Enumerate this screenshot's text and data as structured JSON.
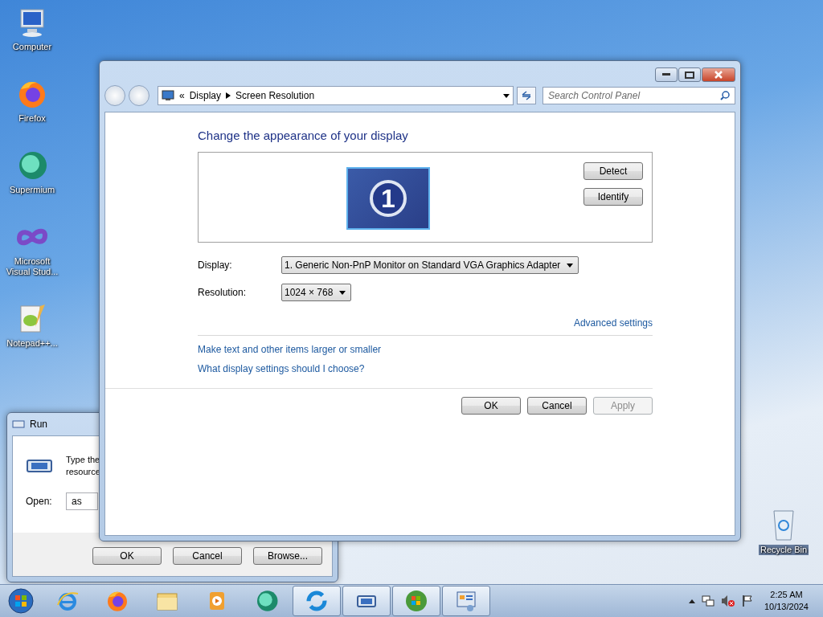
{
  "desktop_icons": [
    {
      "label": "Computer",
      "kind": "computer"
    },
    {
      "label": "Firefox",
      "kind": "firefox"
    },
    {
      "label": "Supermium",
      "kind": "supermium"
    },
    {
      "label": "Microsoft Visual Stud...",
      "kind": "vs"
    },
    {
      "label": "Notepad++...",
      "kind": "notepad"
    }
  ],
  "recycle_bin": {
    "label": "Recycle Bin"
  },
  "run_dialog": {
    "title": "Run",
    "prompt_lines": [
      "Type the",
      "resource"
    ],
    "open_label": "Open:",
    "open_value": "as",
    "buttons": [
      "OK",
      "Cancel",
      "Browse..."
    ]
  },
  "window": {
    "address": {
      "chevron": "«",
      "items": [
        "Display",
        "Screen Resolution"
      ]
    },
    "search": {
      "placeholder": "Search Control Panel"
    },
    "heading": "Change the appearance of your display",
    "monitor_number": "1",
    "preview_buttons": [
      "Detect",
      "Identify"
    ],
    "fields": [
      {
        "label": "Display:",
        "value": "1. Generic Non-PnP Monitor on Standard VGA Graphics Adapter"
      },
      {
        "label": "Resolution:",
        "value": "1024 × 768"
      }
    ],
    "advanced_link": "Advanced settings",
    "links": [
      "Make text and other items larger or smaller",
      "What display settings should I choose?"
    ],
    "buttons": [
      {
        "label": "OK",
        "disabled": false
      },
      {
        "label": "Cancel",
        "disabled": false
      },
      {
        "label": "Apply",
        "disabled": true
      }
    ]
  },
  "taskbar": {
    "pinned": [
      {
        "kind": "ie",
        "running": false
      },
      {
        "kind": "firefox",
        "running": false
      },
      {
        "kind": "folder",
        "running": false
      },
      {
        "kind": "media",
        "running": false
      },
      {
        "kind": "supermium",
        "running": false
      },
      {
        "kind": "sync",
        "running": true
      },
      {
        "kind": "run",
        "running": true
      },
      {
        "kind": "orb",
        "running": true
      },
      {
        "kind": "panel",
        "running": true
      }
    ],
    "time": "2:25 AM",
    "date": "10/13/2024"
  }
}
